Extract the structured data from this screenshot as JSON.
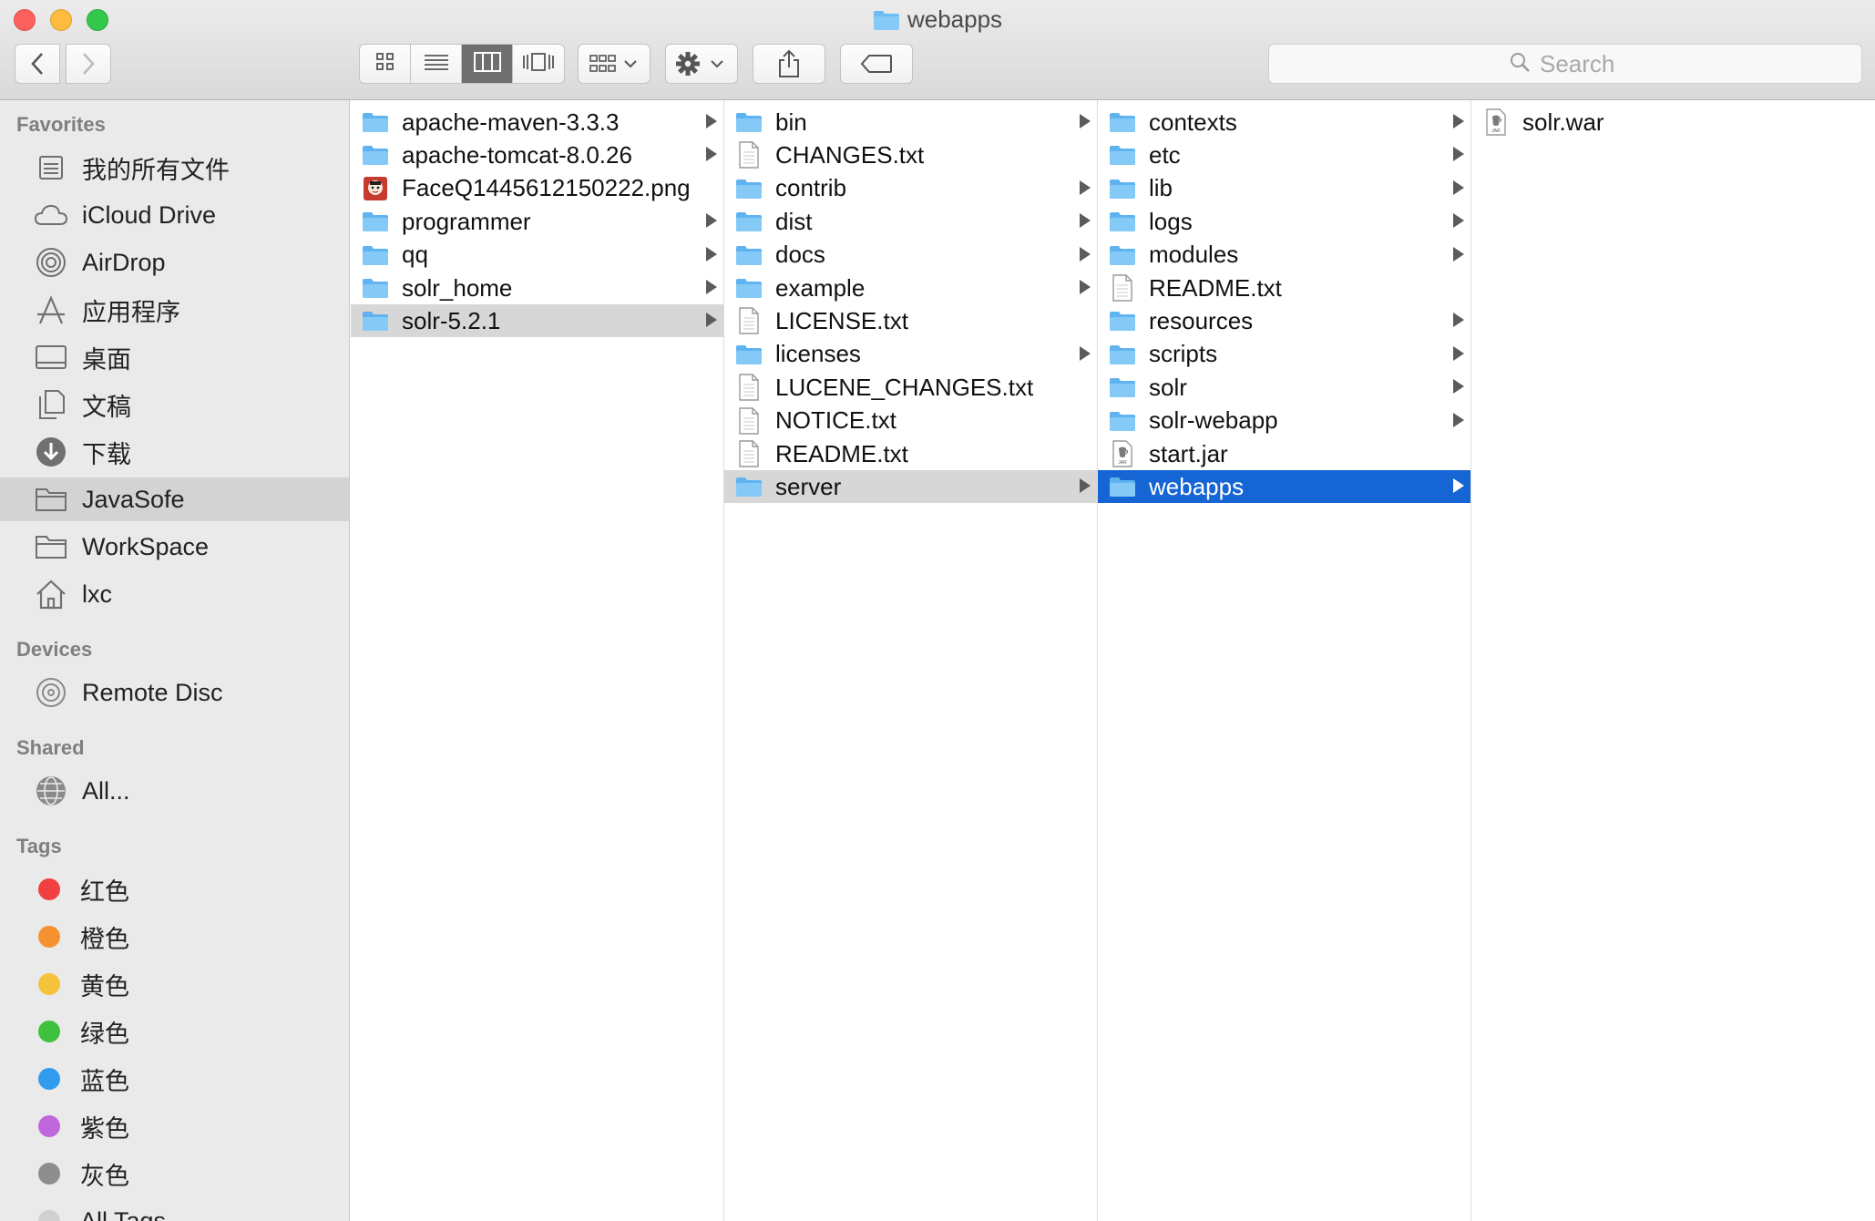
{
  "window": {
    "title": "webapps"
  },
  "toolbar": {
    "back_icon": "chevron-left-icon",
    "forward_icon": "chevron-right-icon",
    "view_modes": [
      "icon-view-icon",
      "list-view-icon",
      "column-view-icon",
      "cover-flow-icon"
    ],
    "active_view": "column-view-icon",
    "search_placeholder": "Search"
  },
  "sidebar": {
    "favorites_header": "Favorites",
    "favorites": [
      {
        "label": "我的所有文件",
        "icon": "all-files-icon"
      },
      {
        "label": "iCloud Drive",
        "icon": "cloud-icon"
      },
      {
        "label": "AirDrop",
        "icon": "airdrop-icon"
      },
      {
        "label": "应用程序",
        "icon": "applications-icon"
      },
      {
        "label": "桌面",
        "icon": "desktop-icon"
      },
      {
        "label": "文稿",
        "icon": "documents-icon"
      },
      {
        "label": "下载",
        "icon": "downloads-icon"
      },
      {
        "label": "JavaSofe",
        "icon": "folder-icon"
      },
      {
        "label": "WorkSpace",
        "icon": "folder-icon"
      },
      {
        "label": "lxc",
        "icon": "home-icon"
      }
    ],
    "devices_header": "Devices",
    "devices": [
      {
        "label": "Remote Disc",
        "icon": "disc-icon"
      }
    ],
    "shared_header": "Shared",
    "shared": [
      {
        "label": "All...",
        "icon": "network-icon"
      }
    ],
    "tags_header": "Tags",
    "tags": [
      {
        "label": "红色",
        "color": "#f0403f"
      },
      {
        "label": "橙色",
        "color": "#f5922f"
      },
      {
        "label": "黄色",
        "color": "#f5c33b"
      },
      {
        "label": "绿色",
        "color": "#3ec23e"
      },
      {
        "label": "蓝色",
        "color": "#2f9cf0"
      },
      {
        "label": "紫色",
        "color": "#c167de"
      },
      {
        "label": "灰色",
        "color": "#8e8e8e"
      },
      {
        "label": "All Tags",
        "color": "#d0d0d0"
      }
    ]
  },
  "columns": [
    [
      {
        "name": "apache-maven-3.3.3",
        "kind": "folder",
        "arrow": true
      },
      {
        "name": "apache-tomcat-8.0.26",
        "kind": "folder",
        "arrow": true
      },
      {
        "name": "FaceQ1445612150222.png",
        "kind": "image",
        "arrow": false
      },
      {
        "name": "programmer",
        "kind": "folder",
        "arrow": true
      },
      {
        "name": "qq",
        "kind": "folder",
        "arrow": true
      },
      {
        "name": "solr_home",
        "kind": "folder",
        "arrow": true
      },
      {
        "name": "solr-5.2.1",
        "kind": "folder",
        "arrow": true,
        "state": "gray"
      }
    ],
    [
      {
        "name": "bin",
        "kind": "folder",
        "arrow": true
      },
      {
        "name": "CHANGES.txt",
        "kind": "doc",
        "arrow": false
      },
      {
        "name": "contrib",
        "kind": "folder",
        "arrow": true
      },
      {
        "name": "dist",
        "kind": "folder",
        "arrow": true
      },
      {
        "name": "docs",
        "kind": "folder",
        "arrow": true
      },
      {
        "name": "example",
        "kind": "folder",
        "arrow": true
      },
      {
        "name": "LICENSE.txt",
        "kind": "doc",
        "arrow": false
      },
      {
        "name": "licenses",
        "kind": "folder",
        "arrow": true
      },
      {
        "name": "LUCENE_CHANGES.txt",
        "kind": "doc",
        "arrow": false
      },
      {
        "name": "NOTICE.txt",
        "kind": "doc",
        "arrow": false
      },
      {
        "name": "README.txt",
        "kind": "doc",
        "arrow": false
      },
      {
        "name": "server",
        "kind": "folder",
        "arrow": true,
        "state": "gray"
      }
    ],
    [
      {
        "name": "contexts",
        "kind": "folder",
        "arrow": true
      },
      {
        "name": "etc",
        "kind": "folder",
        "arrow": true
      },
      {
        "name": "lib",
        "kind": "folder",
        "arrow": true
      },
      {
        "name": "logs",
        "kind": "folder",
        "arrow": true
      },
      {
        "name": "modules",
        "kind": "folder",
        "arrow": true
      },
      {
        "name": "README.txt",
        "kind": "doc",
        "arrow": false
      },
      {
        "name": "resources",
        "kind": "folder",
        "arrow": true
      },
      {
        "name": "scripts",
        "kind": "folder",
        "arrow": true
      },
      {
        "name": "solr",
        "kind": "folder",
        "arrow": true
      },
      {
        "name": "solr-webapp",
        "kind": "folder",
        "arrow": true
      },
      {
        "name": "start.jar",
        "kind": "jar",
        "arrow": false
      },
      {
        "name": "webapps",
        "kind": "folder",
        "arrow": true,
        "state": "blue"
      }
    ],
    [
      {
        "name": "solr.war",
        "kind": "jar",
        "arrow": false
      }
    ]
  ],
  "colors": {
    "selection_blue": "#1565d4",
    "selection_gray": "#d7d7d7",
    "folder_blue": "#6cbcf5"
  }
}
